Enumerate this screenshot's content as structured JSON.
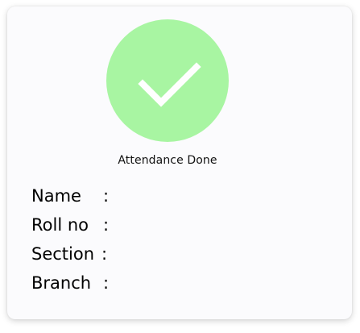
{
  "card": {
    "status_icon": "checkmark-icon",
    "status_color": "#a8f5a2",
    "status_text": "Attendance Done"
  },
  "fields": [
    {
      "label": "Name",
      "separator": ":",
      "value": ""
    },
    {
      "label": "Roll no",
      "separator": ":",
      "value": ""
    },
    {
      "label": "Section",
      "separator": ":",
      "value": ""
    },
    {
      "label": "Branch",
      "separator": ":",
      "value": ""
    }
  ]
}
